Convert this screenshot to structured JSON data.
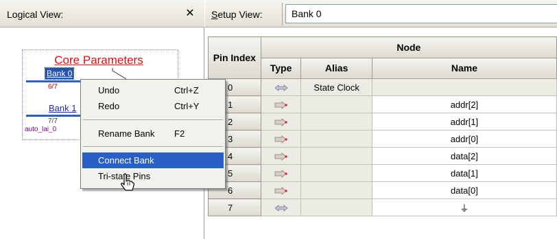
{
  "logical_view": {
    "title": "Logical View:",
    "close_glyph": "✕",
    "diagram": {
      "heading": "Core Parameters",
      "banks": [
        {
          "label": "Bank 0",
          "count": "6/7"
        },
        {
          "label": "Bank 1",
          "count": "7/7"
        }
      ],
      "signal": "auto_lai_0"
    }
  },
  "context_menu": {
    "items": [
      {
        "label": "Undo",
        "shortcut": "Ctrl+Z"
      },
      {
        "label": "Redo",
        "shortcut": "Ctrl+Y"
      },
      {
        "label": "Rename Bank",
        "shortcut": "F2"
      },
      {
        "label": "Connect Bank",
        "shortcut": ""
      },
      {
        "label": "Tri-state Pins",
        "shortcut": ""
      }
    ],
    "highlighted": "Connect Bank",
    "cursor_icon": "hand-pointer-icon"
  },
  "setup_view": {
    "label_prefix": "S",
    "label_rest": "etup View:",
    "bank_value": "Bank 0",
    "table": {
      "headers": {
        "pin_index": "Pin Index",
        "node": "Node",
        "type": "Type",
        "alias": "Alias",
        "name": "Name"
      },
      "rows": [
        {
          "pin": "0",
          "type": "clock",
          "alias": "State Clock",
          "name": ""
        },
        {
          "pin": "1",
          "type": "input",
          "alias": "",
          "name": "addr[2]"
        },
        {
          "pin": "2",
          "type": "input",
          "alias": "",
          "name": "addr[1]"
        },
        {
          "pin": "3",
          "type": "input",
          "alias": "",
          "name": "addr[0]"
        },
        {
          "pin": "4",
          "type": "input",
          "alias": "",
          "name": "data[2]"
        },
        {
          "pin": "5",
          "type": "input",
          "alias": "",
          "name": "data[1]"
        },
        {
          "pin": "6",
          "type": "input",
          "alias": "",
          "name": "data[0]"
        },
        {
          "pin": "7",
          "type": "clock",
          "alias": "",
          "name": "⏚"
        }
      ]
    }
  },
  "colors": {
    "menu_highlight": "#2a5fc8",
    "core_params": "#d0140e",
    "bank_line": "#2a5fd0",
    "signal": "#800080"
  }
}
